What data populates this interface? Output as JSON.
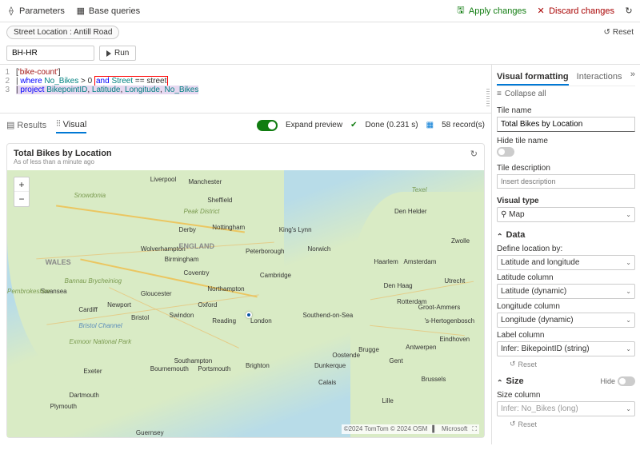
{
  "toolbar": {
    "parameters": "Parameters",
    "base_queries": "Base queries",
    "apply": "Apply changes",
    "discard": "Discard changes",
    "reset": "Reset"
  },
  "filter": {
    "pill": "Street Location : Antill Road"
  },
  "query": {
    "input_value": "BH-HR",
    "run": "Run",
    "lines": [
      {
        "pre": "[",
        "str": "'bike-count'",
        "post": "]"
      },
      {
        "op": "|",
        "kw": "where",
        "col1": "No_Bikes",
        "cmp": "> 0",
        "hl": "and Street == street"
      },
      {
        "op": "|",
        "kw": "project",
        "cols": "BikepointID, Latitude, Longitude, No_Bikes"
      }
    ]
  },
  "tabs": {
    "results": "Results",
    "visual": "Visual",
    "expand": "Expand preview",
    "done": "Done (0.231 s)",
    "records": "58 record(s)"
  },
  "tile": {
    "title": "Total Bikes by Location",
    "subtitle": "As of less than a minute ago"
  },
  "map": {
    "zoom_in": "+",
    "zoom_out": "−",
    "attribution1": "©2024 TomTom © 2024 OSM",
    "attribution2": "Microsoft",
    "cities": {
      "liverpool": "Liverpool",
      "manchester": "Manchester",
      "sheffield": "Sheffield",
      "peak": "Peak District",
      "derby": "Derby",
      "nottingham": "Nottingham",
      "kings_lynn": "King's Lynn",
      "wolverhampton": "Wolverhampton",
      "birmingham": "Birmingham",
      "peterborough": "Peterborough",
      "norwich": "Norwich",
      "coventry": "Coventry",
      "cambridge": "Cambridge",
      "northampton": "Northampton",
      "gloucester": "Gloucester",
      "oxford": "Oxford",
      "swindon": "Swindon",
      "reading": "Reading",
      "london": "London",
      "southend": "Southend-on-Sea",
      "bristol": "Bristol",
      "bristol_channel": "Bristol Channel",
      "cardiff": "Cardiff",
      "newport": "Newport",
      "swansea": "Swansea",
      "exeter": "Exeter",
      "bournemouth": "Bournemouth",
      "southampton": "Southampton",
      "portsmouth": "Portsmouth",
      "brighton": "Brighton",
      "plymouth": "Plymouth",
      "dartmouth": "Dartmouth",
      "guernsey": "Guernsey",
      "wales": "WALES",
      "england": "ENGLAND",
      "exmoor": "Exmoor National Park",
      "pembroke": "Pembrokeshire",
      "snowdonia": "Snowdonia",
      "brycheiniog": "Bannau Brycheiniog",
      "amsterdam": "Amsterdam",
      "haarlem": "Haarlem",
      "den_haag": "Den Haag",
      "rotterdam": "Rotterdam",
      "utrecht": "Utrecht",
      "zwolle": "Zwolle",
      "den_helder": "Den Helder",
      "groot": "Groot-Ammers",
      "antwerpen": "Antwerpen",
      "gent": "Gent",
      "brugge": "Brugge",
      "brussels": "Brussels",
      "lille": "Lille",
      "oostende": "Oostende",
      "dunkirk": "Dunkerque",
      "calais": "Calais",
      "s_hertogen": "'s-Hertogenbosch",
      "eindhoven": "Eindhoven",
      "texel": "Texel"
    }
  },
  "side": {
    "tab_visual": "Visual formatting",
    "tab_inter": "Interactions",
    "collapse_all": "Collapse all",
    "tile_name_label": "Tile name",
    "tile_name_value": "Total Bikes by Location",
    "hide_tile_name": "Hide tile name",
    "tile_desc_label": "Tile description",
    "tile_desc_placeholder": "Insert description",
    "visual_type_label": "Visual type",
    "visual_type_value": "Map",
    "data_section": "Data",
    "define_location": "Define location by:",
    "define_location_value": "Latitude and longitude",
    "lat_col": "Latitude column",
    "lat_val": "Latitude (dynamic)",
    "lon_col": "Longitude column",
    "lon_val": "Longitude (dynamic)",
    "label_col": "Label column",
    "label_val": "Infer: BikepointID (string)",
    "reset": "Reset",
    "size_section": "Size",
    "hide": "Hide",
    "size_col": "Size column",
    "size_val": "Infer: No_Bikes (long)"
  }
}
